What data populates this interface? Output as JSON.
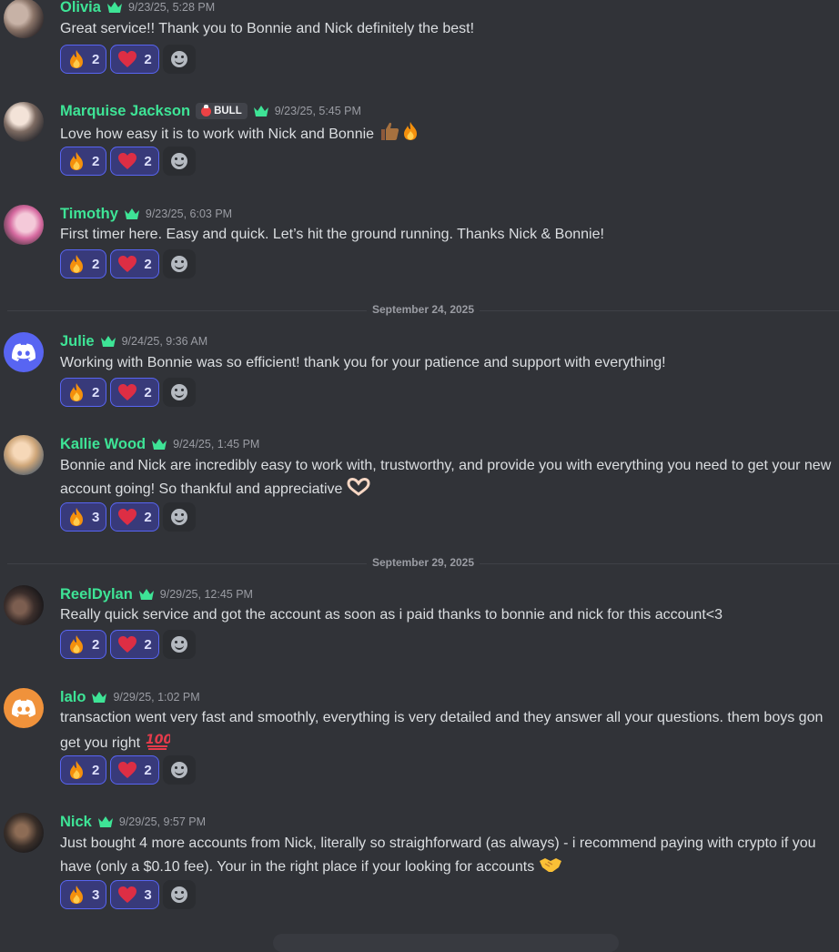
{
  "colors": {
    "username": "#3ee496",
    "background": "#313338",
    "reaction_bg": "#383a7a",
    "reaction_border": "#5865f2"
  },
  "messages": [
    {
      "username": "Olivia",
      "time": "9/23/25, 5:28 PM",
      "text": "Great service!! Thank you to Bonnie and Nick definitely the best!",
      "fire": "2",
      "heart": "2"
    },
    {
      "username": "Marquise Jackson",
      "tag": "BULL",
      "time": "9/23/25, 5:45 PM",
      "text": "Love how easy it is to work with Nick and Bonnie",
      "fire": "2",
      "heart": "2"
    },
    {
      "username": "Timothy",
      "time": "9/23/25, 6:03 PM",
      "text": "First timer here. Easy and quick. Let’s hit the ground running. Thanks Nick & Bonnie!",
      "fire": "2",
      "heart": "2"
    },
    {
      "username": "Julie",
      "time": "9/24/25, 9:36 AM",
      "text": "Working with Bonnie was so efficient! thank you for your patience and support with everything!",
      "fire": "2",
      "heart": "2"
    },
    {
      "username": "Kallie Wood",
      "time": "9/24/25, 1:45 PM",
      "text": "Bonnie and Nick are incredibly easy to work with, trustworthy, and provide you with everything you need to get your new account going! So thankful and appreciative",
      "fire": "3",
      "heart": "2"
    },
    {
      "username": "ReelDylan",
      "time": "9/29/25, 12:45 PM",
      "text": "Really quick service and got the account as soon as i paid thanks to bonnie and nick for this account<3",
      "fire": "2",
      "heart": "2"
    },
    {
      "username": "lalo",
      "time": "9/29/25, 1:02 PM",
      "text": "transaction went very fast and smoothly, everything is very detailed and they answer all your questions. them boys gon get you right",
      "fire": "2",
      "heart": "2"
    },
    {
      "username": "Nick",
      "time": "9/29/25, 9:57 PM",
      "text": "Just bought 4 more accounts from Nick, literally so straighforward (as always) - i recommend paying with crypto if you have (only a $0.10 fee). Your in the right place if your looking for accounts",
      "fire": "3",
      "heart": "3"
    }
  ],
  "dividers": [
    "September 24, 2025",
    "September 29, 2025"
  ]
}
